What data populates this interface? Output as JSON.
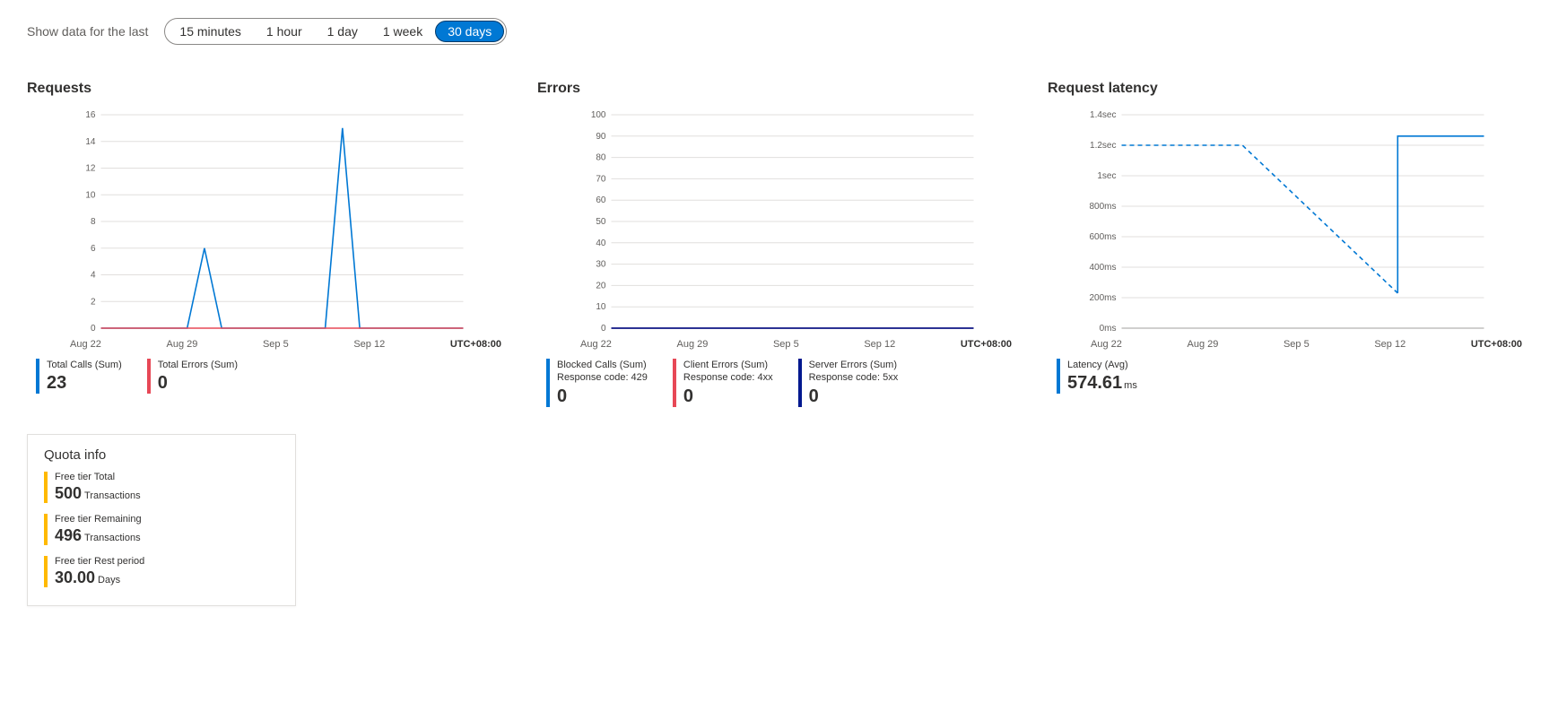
{
  "time_selector": {
    "label": "Show data for the last",
    "options": [
      "15 minutes",
      "1 hour",
      "1 day",
      "1 week",
      "30 days"
    ],
    "selected_index": 4
  },
  "timezone": "UTC+08:00",
  "charts": {
    "requests": {
      "title": "Requests",
      "legend": [
        {
          "label": "Total Calls (Sum)",
          "sub": "",
          "value": "23",
          "unit": "",
          "color": "#0078d4"
        },
        {
          "label": "Total Errors (Sum)",
          "sub": "",
          "value": "0",
          "unit": "",
          "color": "#e74856"
        }
      ]
    },
    "errors": {
      "title": "Errors",
      "legend": [
        {
          "label": "Blocked Calls (Sum)",
          "sub": "Response code: 429",
          "value": "0",
          "unit": "",
          "color": "#0078d4"
        },
        {
          "label": "Client Errors (Sum)",
          "sub": "Response code: 4xx",
          "value": "0",
          "unit": "",
          "color": "#e74856"
        },
        {
          "label": "Server Errors (Sum)",
          "sub": "Response code: 5xx",
          "value": "0",
          "unit": "",
          "color": "#00188f"
        }
      ]
    },
    "latency": {
      "title": "Request latency",
      "legend": [
        {
          "label": "Latency (Avg)",
          "sub": "",
          "value": "574.61",
          "unit": "ms",
          "color": "#0078d4"
        }
      ]
    }
  },
  "quota": {
    "title": "Quota info",
    "items": [
      {
        "label": "Free tier Total",
        "value": "500",
        "unit": "Transactions"
      },
      {
        "label": "Free tier Remaining",
        "value": "496",
        "unit": "Transactions"
      },
      {
        "label": "Free tier Rest period",
        "value": "30.00",
        "unit": "Days"
      }
    ]
  },
  "chart_data": [
    {
      "id": "requests",
      "type": "line",
      "title": "Requests",
      "x_categories": [
        "Aug 22",
        "Aug 29",
        "Sep 5",
        "Sep 12"
      ],
      "y_ticks": [
        0,
        2,
        4,
        6,
        8,
        10,
        12,
        14,
        16
      ],
      "ylim": [
        0,
        16
      ],
      "series": [
        {
          "name": "Total Calls (Sum)",
          "color": "#0078d4",
          "x": [
            "Aug 22",
            "Aug 27",
            "Aug 28",
            "Aug 29",
            "Sep 4",
            "Sep 5",
            "Sep 6",
            "Sep 7",
            "Sep 12"
          ],
          "values": [
            0,
            0,
            6,
            0,
            0,
            15,
            0,
            0,
            0
          ]
        },
        {
          "name": "Total Errors (Sum)",
          "color": "#e74856",
          "x": [
            "Aug 22",
            "Sep 12"
          ],
          "values": [
            0,
            0
          ]
        }
      ]
    },
    {
      "id": "errors",
      "type": "line",
      "title": "Errors",
      "x_categories": [
        "Aug 22",
        "Aug 29",
        "Sep 5",
        "Sep 12"
      ],
      "y_ticks": [
        0,
        10,
        20,
        30,
        40,
        50,
        60,
        70,
        80,
        90,
        100
      ],
      "ylim": [
        0,
        100
      ],
      "series": [
        {
          "name": "Blocked Calls (Sum)",
          "color": "#0078d4",
          "x": [
            "Aug 22",
            "Sep 12"
          ],
          "values": [
            0,
            0
          ]
        },
        {
          "name": "Client Errors (Sum)",
          "color": "#e74856",
          "x": [
            "Aug 22",
            "Sep 12"
          ],
          "values": [
            0,
            0
          ]
        },
        {
          "name": "Server Errors (Sum)",
          "color": "#00188f",
          "x": [
            "Aug 22",
            "Sep 12"
          ],
          "values": [
            0,
            0
          ]
        }
      ]
    },
    {
      "id": "latency",
      "type": "line",
      "title": "Request latency",
      "x_categories": [
        "Aug 22",
        "Aug 29",
        "Sep 5",
        "Sep 12"
      ],
      "y_ticks_labels": [
        "0ms",
        "200ms",
        "400ms",
        "600ms",
        "800ms",
        "1sec",
        "1.2sec",
        "1.4sec"
      ],
      "y_ticks_values": [
        0,
        200,
        400,
        600,
        800,
        1000,
        1200,
        1400
      ],
      "ylim": [
        0,
        1400
      ],
      "series": [
        {
          "name": "Latency (Avg) solid",
          "color": "#0078d4",
          "dash": false,
          "x": [
            "Sep 7",
            "Sep 7",
            "Sep 12"
          ],
          "values": [
            230,
            1260,
            1260
          ]
        },
        {
          "name": "Latency (Avg) dashed",
          "color": "#0078d4",
          "dash": true,
          "x": [
            "Aug 22",
            "Aug 29",
            "Sep 7"
          ],
          "values": [
            1200,
            1200,
            230
          ]
        }
      ]
    }
  ]
}
